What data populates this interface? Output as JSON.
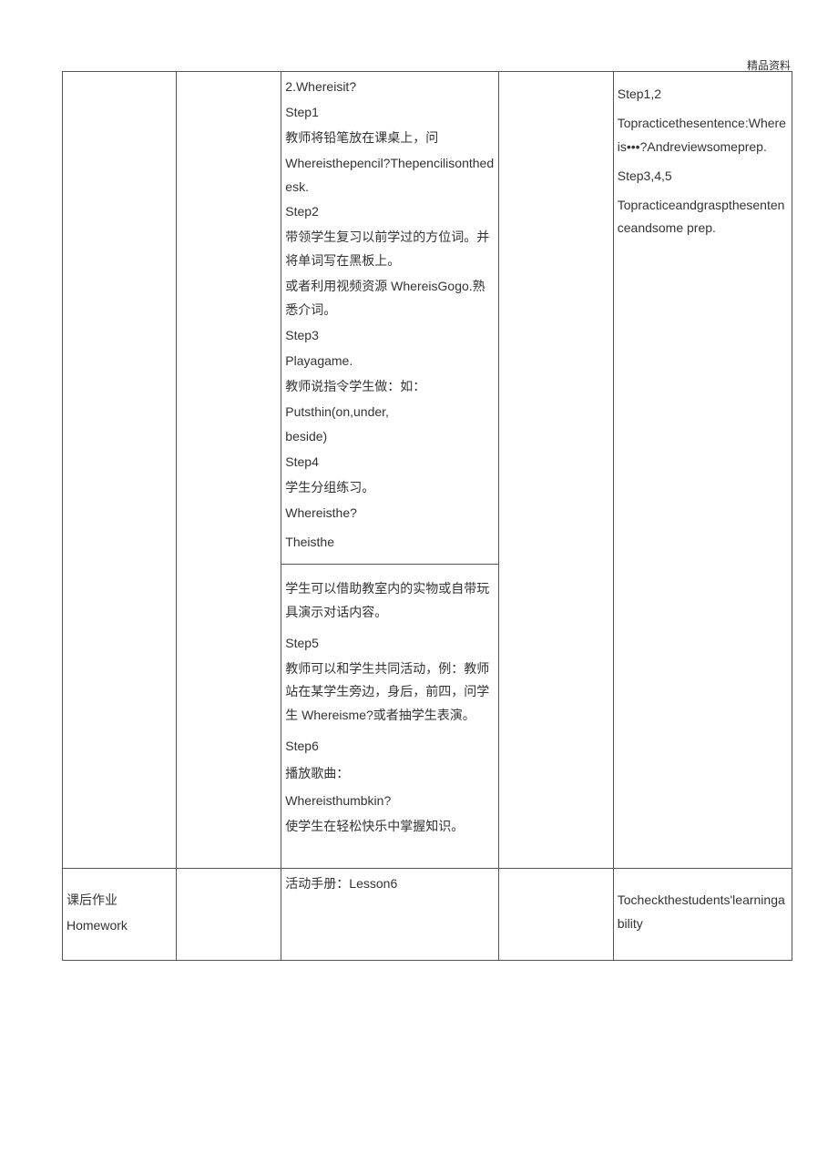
{
  "top_label": "精品资料",
  "table": {
    "row1": {
      "col3a": {
        "l1": "2.Whereisit?",
        "l2": "Step1",
        "l3": "教师将铅笔放在课桌上，问",
        "l4": " Whereisthepencil?Thepencilisonthedesk.",
        "l5": " Step2",
        "l6": " 带领学生复习以前学过的方位词。并将单词写在黑板上。",
        "l7": " 或者利用视频资源 WhereisGogo.熟悉介词。",
        "l8": " Step3",
        "l9": " Playagame.",
        "l10": " 教师说指令学生做：如：",
        "l11": "Putsthin(on,under,",
        "l12": " beside)",
        "l13": " Step4",
        "l14": "学生分组练习。",
        "l15": "Whereisthe?",
        "l16": "Theisthe"
      },
      "col3b": {
        "l1": " 学生可以借助教室内的实物或自带玩具演示对话内容。",
        "l2": "Step5",
        "l3": " 教师可以和学生共同活动，例：教师站在某学生旁边，身后，前四，问学生 Whereisme?或者抽学生表演。",
        "l4": "Step6",
        "l5": "播放歌曲：",
        "l6": "Whereisthumbkin?",
        "l7": " 使学生在轻松快乐中掌握知识。"
      },
      "col5": {
        "l1": "Step1,2",
        "l2": "Topracticethesentence:Whereis•••?Andreviewsomeprep.",
        "l3": "Step3,4,5",
        "l4": "Topracticeandgraspthesentenceandsome prep."
      }
    },
    "row2": {
      "col1": {
        "l1": "课后作业",
        "l2": "Homework"
      },
      "col3": {
        "l1": "活动手册：Lesson6"
      },
      "col5": {
        "l1": "Tocheckthestudents'learningability"
      }
    }
  }
}
